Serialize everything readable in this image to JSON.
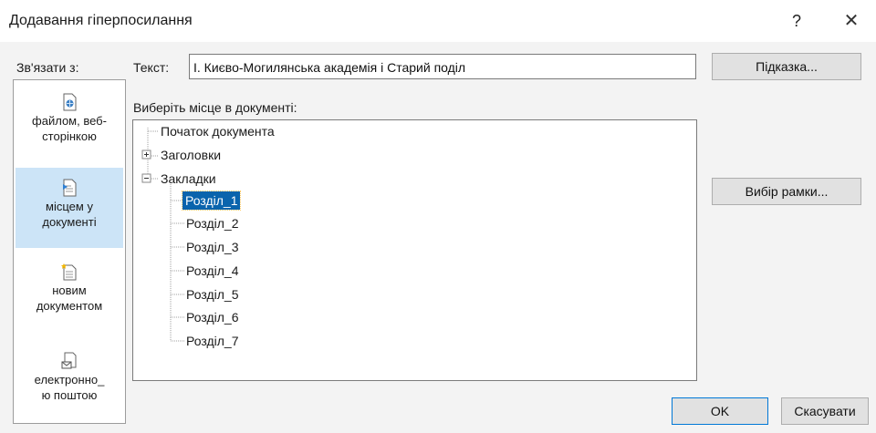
{
  "dialog": {
    "title": "Додавання гіперпосилання",
    "help_glyph": "?",
    "close_glyph": "✕"
  },
  "link_to_label": "Зв'язати з:",
  "text": {
    "label": "Текст:",
    "value": "І. Києво-Могилянська академія і Старий поділ"
  },
  "buttons": {
    "hint": "Підказка...",
    "frame": "Вибір рамки...",
    "ok": "OK",
    "cancel": "Скасувати"
  },
  "sidebar": {
    "items": [
      {
        "line1": "файлом, веб-",
        "line2": "сторінкою",
        "icon": "file-web-page-icon",
        "selected": false
      },
      {
        "line1": "місцем у",
        "line2": "документі",
        "icon": "place-in-document-icon",
        "selected": true
      },
      {
        "line1": "новим",
        "line2": "документом",
        "icon": "new-document-icon",
        "selected": false
      },
      {
        "line1": "електронно_",
        "line2": "ю поштою",
        "icon": "email-icon",
        "selected": false
      }
    ]
  },
  "place_label": "Виберіть місце в документі:",
  "tree": {
    "top_of_document": "Початок документа",
    "headings": "Заголовки",
    "bookmarks": "Закладки",
    "bookmark_items": [
      "Розділ_1",
      "Розділ_2",
      "Розділ_3",
      "Розділ_4",
      "Розділ_5",
      "Розділ_6",
      "Розділ_7"
    ],
    "selected_item": "Розділ_1"
  },
  "colors": {
    "selection": "#0a64ad",
    "sidebar_selected": "#cce4f7",
    "dialog_bg": "#f3f3f3"
  }
}
